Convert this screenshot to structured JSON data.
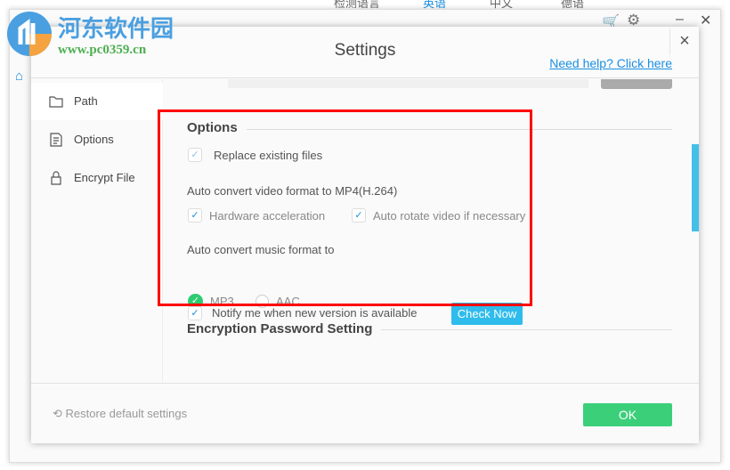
{
  "background": {
    "languages": [
      "检测语言",
      "英语",
      "中文",
      "德语"
    ]
  },
  "watermark": {
    "name": "河东软件园",
    "url": "www.pc0359.cn"
  },
  "dialog": {
    "title": "Settings",
    "help_link": "Need help? Click here",
    "close": "×"
  },
  "sidebar": {
    "items": [
      {
        "label": "Path",
        "icon": "folder-icon"
      },
      {
        "label": "Options",
        "icon": "document-list-icon"
      },
      {
        "label": "Encrypt File",
        "icon": "lock-icon"
      }
    ]
  },
  "options": {
    "heading": "Options",
    "replace_existing": {
      "label": "Replace existing files",
      "checked": true
    },
    "video_heading": "Auto convert video format to MP4(H.264)",
    "hardware_accel": {
      "label": "Hardware acceleration",
      "checked": true
    },
    "auto_rotate": {
      "label": "Auto rotate video if necessary",
      "checked": true
    },
    "music_heading": "Auto convert music format to",
    "music_formats": [
      {
        "label": "MP3",
        "selected": true
      },
      {
        "label": "AAC",
        "selected": false
      }
    ],
    "notify": {
      "label": "Notify me when new version is available",
      "checked": true
    },
    "check_now": "Check Now"
  },
  "encryption": {
    "heading": "Encryption Password Setting"
  },
  "footer": {
    "restore": "Restore default settings",
    "ok": "OK"
  },
  "colors": {
    "accent": "#2fbcec",
    "ok": "#3ccf7a",
    "link": "#1a8fe0",
    "highlight": "#ff0000"
  }
}
